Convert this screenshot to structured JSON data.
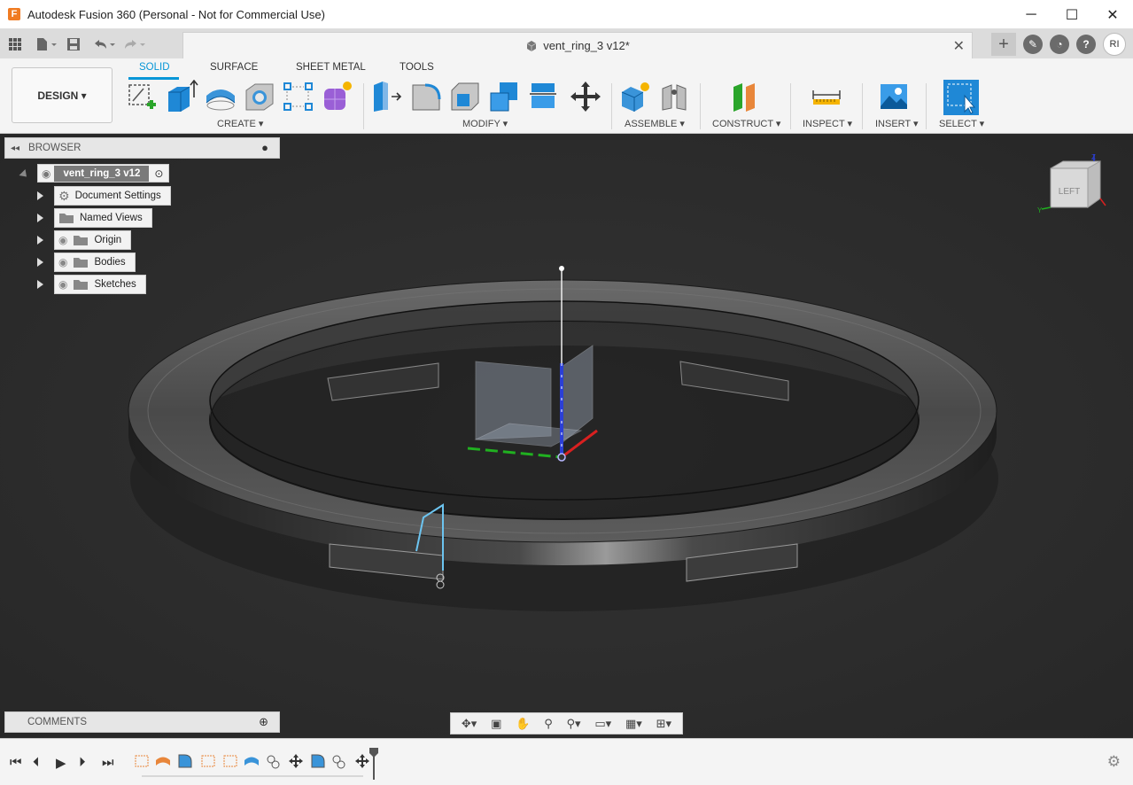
{
  "window": {
    "title": "Autodesk Fusion 360 (Personal - Not for Commercial Use)",
    "minimize": "─",
    "maximize": "☐",
    "close": "✕"
  },
  "tabbar": {
    "document_tab": "vent_ring_3 v12*",
    "close_tab": "✕",
    "avatar": "RI"
  },
  "ribbon": {
    "workspace": "DESIGN ▾",
    "tabs": [
      "SOLID",
      "SURFACE",
      "SHEET METAL",
      "TOOLS"
    ],
    "groups": [
      "CREATE ▾",
      "MODIFY ▾",
      "ASSEMBLE ▾",
      "CONSTRUCT ▾",
      "INSPECT ▾",
      "INSERT ▾",
      "SELECT ▾"
    ]
  },
  "browser": {
    "title": "BROWSER",
    "root": "vent_ring_3 v12",
    "items": [
      {
        "label": "Document Settings"
      },
      {
        "label": "Named Views"
      },
      {
        "label": "Origin"
      },
      {
        "label": "Bodies"
      },
      {
        "label": "Sketches"
      }
    ]
  },
  "comments": {
    "title": "COMMENTS"
  },
  "viewcube": {
    "face": "LEFT",
    "axis_y": "Y",
    "axis_z": "Z"
  },
  "colors": {
    "accent": "#0696d7",
    "viewport_bg": "#2b2b2b",
    "axis_x": "#e02020",
    "axis_y": "#1fb31f",
    "axis_z": "#1f3fd0"
  }
}
